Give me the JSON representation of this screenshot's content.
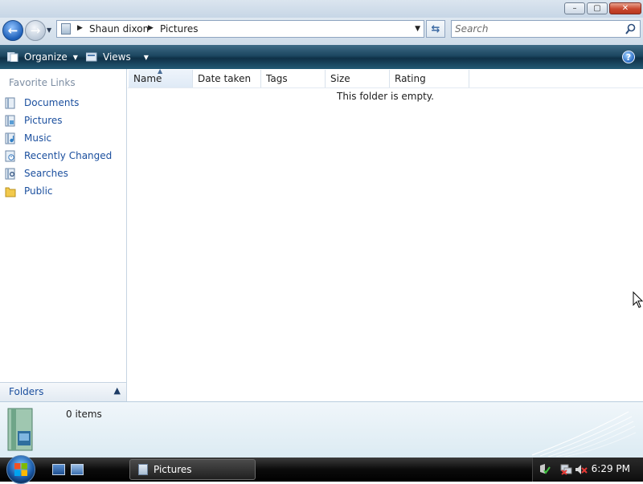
{
  "window": {
    "controls": {
      "minimize": "–",
      "maximize": "▢",
      "close": "✕"
    }
  },
  "address": {
    "crumbs": [
      "Shaun dixon",
      "Pictures"
    ],
    "back_icon": "back-arrow-icon",
    "forward_icon": "forward-arrow-icon"
  },
  "search": {
    "placeholder": "Search"
  },
  "toolbar": {
    "organize_label": "Organize",
    "views_label": "Views",
    "help_label": "?"
  },
  "nav": {
    "header": "Favorite Links",
    "items": [
      {
        "label": "Documents",
        "icon": "documents-icon"
      },
      {
        "label": "Pictures",
        "icon": "pictures-icon"
      },
      {
        "label": "Music",
        "icon": "music-icon"
      },
      {
        "label": "Recently Changed",
        "icon": "recently-changed-icon"
      },
      {
        "label": "Searches",
        "icon": "searches-icon"
      },
      {
        "label": "Public",
        "icon": "public-folder-icon"
      }
    ],
    "folders_label": "Folders"
  },
  "columns": [
    "Name",
    "Date taken",
    "Tags",
    "Size",
    "Rating"
  ],
  "content": {
    "empty_message": "This folder is empty."
  },
  "details": {
    "item_count": "0 items"
  },
  "taskbar": {
    "task_label": "Pictures",
    "clock": "6:29 PM"
  },
  "colors": {
    "link_blue": "#1b4f9e",
    "toolbar_dark": "#1c4660",
    "taskbar_black": "#0b0b0b"
  }
}
